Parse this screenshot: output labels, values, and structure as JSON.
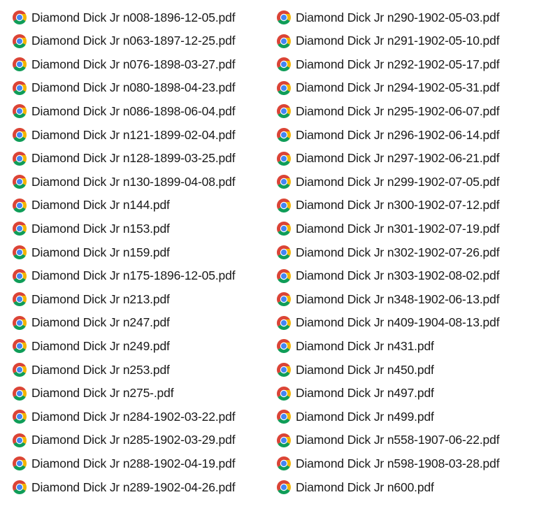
{
  "icon": "chrome-pdf-icon",
  "colors": {
    "text": "#1a1a1a",
    "icon_red": "#db4437",
    "icon_yellow": "#f4b400",
    "icon_green": "#0f9d58",
    "icon_blue": "#4285f4"
  },
  "columns": [
    {
      "files": [
        {
          "name": "Diamond Dick Jr n008-1896-12-05.pdf"
        },
        {
          "name": "Diamond Dick Jr n063-1897-12-25.pdf"
        },
        {
          "name": "Diamond Dick Jr n076-1898-03-27.pdf"
        },
        {
          "name": "Diamond Dick Jr n080-1898-04-23.pdf"
        },
        {
          "name": "Diamond Dick Jr n086-1898-06-04.pdf"
        },
        {
          "name": "Diamond Dick Jr n121-1899-02-04.pdf"
        },
        {
          "name": "Diamond Dick Jr n128-1899-03-25.pdf"
        },
        {
          "name": "Diamond Dick Jr n130-1899-04-08.pdf"
        },
        {
          "name": "Diamond Dick Jr n144.pdf"
        },
        {
          "name": "Diamond Dick Jr n153.pdf"
        },
        {
          "name": "Diamond Dick Jr n159.pdf"
        },
        {
          "name": "Diamond Dick Jr n175-1896-12-05.pdf"
        },
        {
          "name": "Diamond Dick Jr n213.pdf"
        },
        {
          "name": "Diamond Dick Jr n247.pdf"
        },
        {
          "name": "Diamond Dick Jr n249.pdf"
        },
        {
          "name": "Diamond Dick Jr n253.pdf"
        },
        {
          "name": "Diamond Dick Jr n275-.pdf"
        },
        {
          "name": "Diamond Dick Jr n284-1902-03-22.pdf"
        },
        {
          "name": "Diamond Dick Jr n285-1902-03-29.pdf"
        },
        {
          "name": "Diamond Dick Jr n288-1902-04-19.pdf"
        },
        {
          "name": "Diamond Dick Jr n289-1902-04-26.pdf"
        }
      ]
    },
    {
      "files": [
        {
          "name": "Diamond Dick Jr n290-1902-05-03.pdf"
        },
        {
          "name": "Diamond Dick Jr n291-1902-05-10.pdf"
        },
        {
          "name": "Diamond Dick Jr n292-1902-05-17.pdf"
        },
        {
          "name": "Diamond Dick Jr n294-1902-05-31.pdf"
        },
        {
          "name": "Diamond Dick Jr n295-1902-06-07.pdf"
        },
        {
          "name": "Diamond Dick Jr n296-1902-06-14.pdf"
        },
        {
          "name": "Diamond Dick Jr n297-1902-06-21.pdf"
        },
        {
          "name": "Diamond Dick Jr n299-1902-07-05.pdf"
        },
        {
          "name": "Diamond Dick Jr n300-1902-07-12.pdf"
        },
        {
          "name": "Diamond Dick Jr n301-1902-07-19.pdf"
        },
        {
          "name": "Diamond Dick Jr n302-1902-07-26.pdf"
        },
        {
          "name": "Diamond Dick Jr n303-1902-08-02.pdf"
        },
        {
          "name": "Diamond Dick Jr n348-1902-06-13.pdf"
        },
        {
          "name": "Diamond Dick Jr n409-1904-08-13.pdf"
        },
        {
          "name": "Diamond Dick Jr n431.pdf"
        },
        {
          "name": "Diamond Dick Jr n450.pdf"
        },
        {
          "name": "Diamond Dick Jr n497.pdf"
        },
        {
          "name": "Diamond Dick Jr n499.pdf"
        },
        {
          "name": "Diamond Dick Jr n558-1907-06-22.pdf"
        },
        {
          "name": "Diamond Dick Jr n598-1908-03-28.pdf"
        },
        {
          "name": "Diamond Dick Jr n600.pdf"
        }
      ]
    }
  ]
}
